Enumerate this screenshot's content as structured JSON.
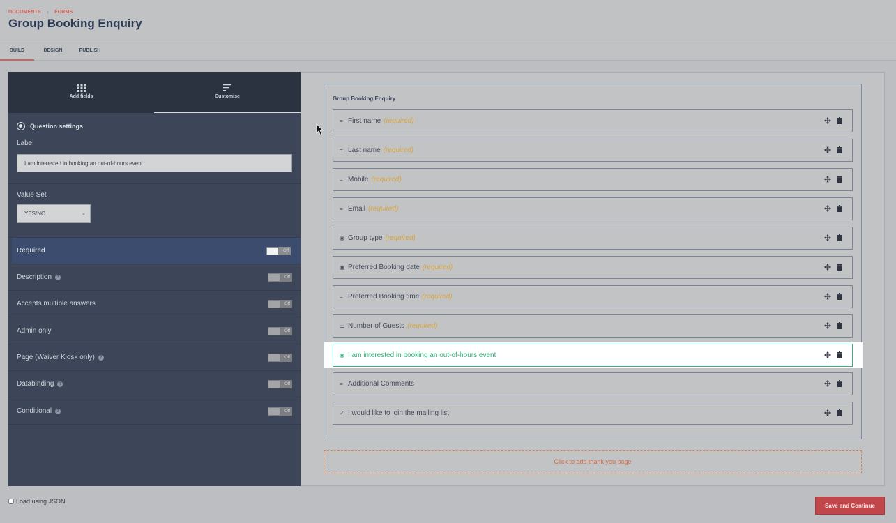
{
  "breadcrumb": {
    "items": [
      "DOCUMENTS",
      "FORMS"
    ]
  },
  "page_title": "Group Booking Enquiry",
  "tabs": [
    {
      "label": "BUILD",
      "active": true
    },
    {
      "label": "DESIGN",
      "active": false
    },
    {
      "label": "PUBLISH",
      "active": false
    }
  ],
  "left_panel": {
    "tabs": [
      {
        "label": "Add fields",
        "icon": "grid-icon",
        "active": false
      },
      {
        "label": "Customise",
        "icon": "sort-lines-icon",
        "active": true
      }
    ],
    "section_title": "Question settings",
    "label_field": {
      "label": "Label",
      "value": "I am interested in booking an out-of-hours event"
    },
    "value_set": {
      "label": "Value Set",
      "selected": "YES/NO"
    },
    "toggles": [
      {
        "label": "Required",
        "state": "Off",
        "help": false,
        "highlighted": true
      },
      {
        "label": "Description",
        "state": "Off",
        "help": true
      },
      {
        "label": "Accepts multiple answers",
        "state": "Off",
        "help": false
      },
      {
        "label": "Admin only",
        "state": "Off",
        "help": false
      },
      {
        "label": "Page (Waiver Kiosk only)",
        "state": "Off",
        "help": true
      },
      {
        "label": "Databinding",
        "state": "Off",
        "help": true
      },
      {
        "label": "Conditional",
        "state": "Off",
        "help": true
      }
    ]
  },
  "form": {
    "title": "Group Booking Enquiry",
    "required_text": "(required)",
    "fields": [
      {
        "name": "First name",
        "icon": "short-text-icon",
        "required": true
      },
      {
        "name": "Last name",
        "icon": "short-text-icon",
        "required": true
      },
      {
        "name": "Mobile",
        "icon": "short-text-icon",
        "required": true
      },
      {
        "name": "Email",
        "icon": "short-text-icon",
        "required": true
      },
      {
        "name": "Group type",
        "icon": "radio-icon",
        "required": true
      },
      {
        "name": "Preferred Booking date",
        "icon": "calendar-icon",
        "required": true
      },
      {
        "name": "Preferred Booking time",
        "icon": "short-text-icon",
        "required": true
      },
      {
        "name": "Number of Guests",
        "icon": "list-icon",
        "required": true
      },
      {
        "name": "I am interested in booking an out-of-hours event",
        "icon": "radio-icon",
        "required": false,
        "selected": true
      },
      {
        "name": "Additional Comments",
        "icon": "short-text-icon",
        "required": false
      },
      {
        "name": "I would like to join the mailing list",
        "icon": "check-icon",
        "required": false
      }
    ],
    "thank_you": "Click to add thank you page"
  },
  "footer": {
    "json_label": "Load using JSON",
    "save_label": "Save and Continue"
  },
  "colors": {
    "accent": "#d0645a",
    "selected": "#2bb37a",
    "required": "#d9a53b",
    "save_button": "#c0464a"
  }
}
